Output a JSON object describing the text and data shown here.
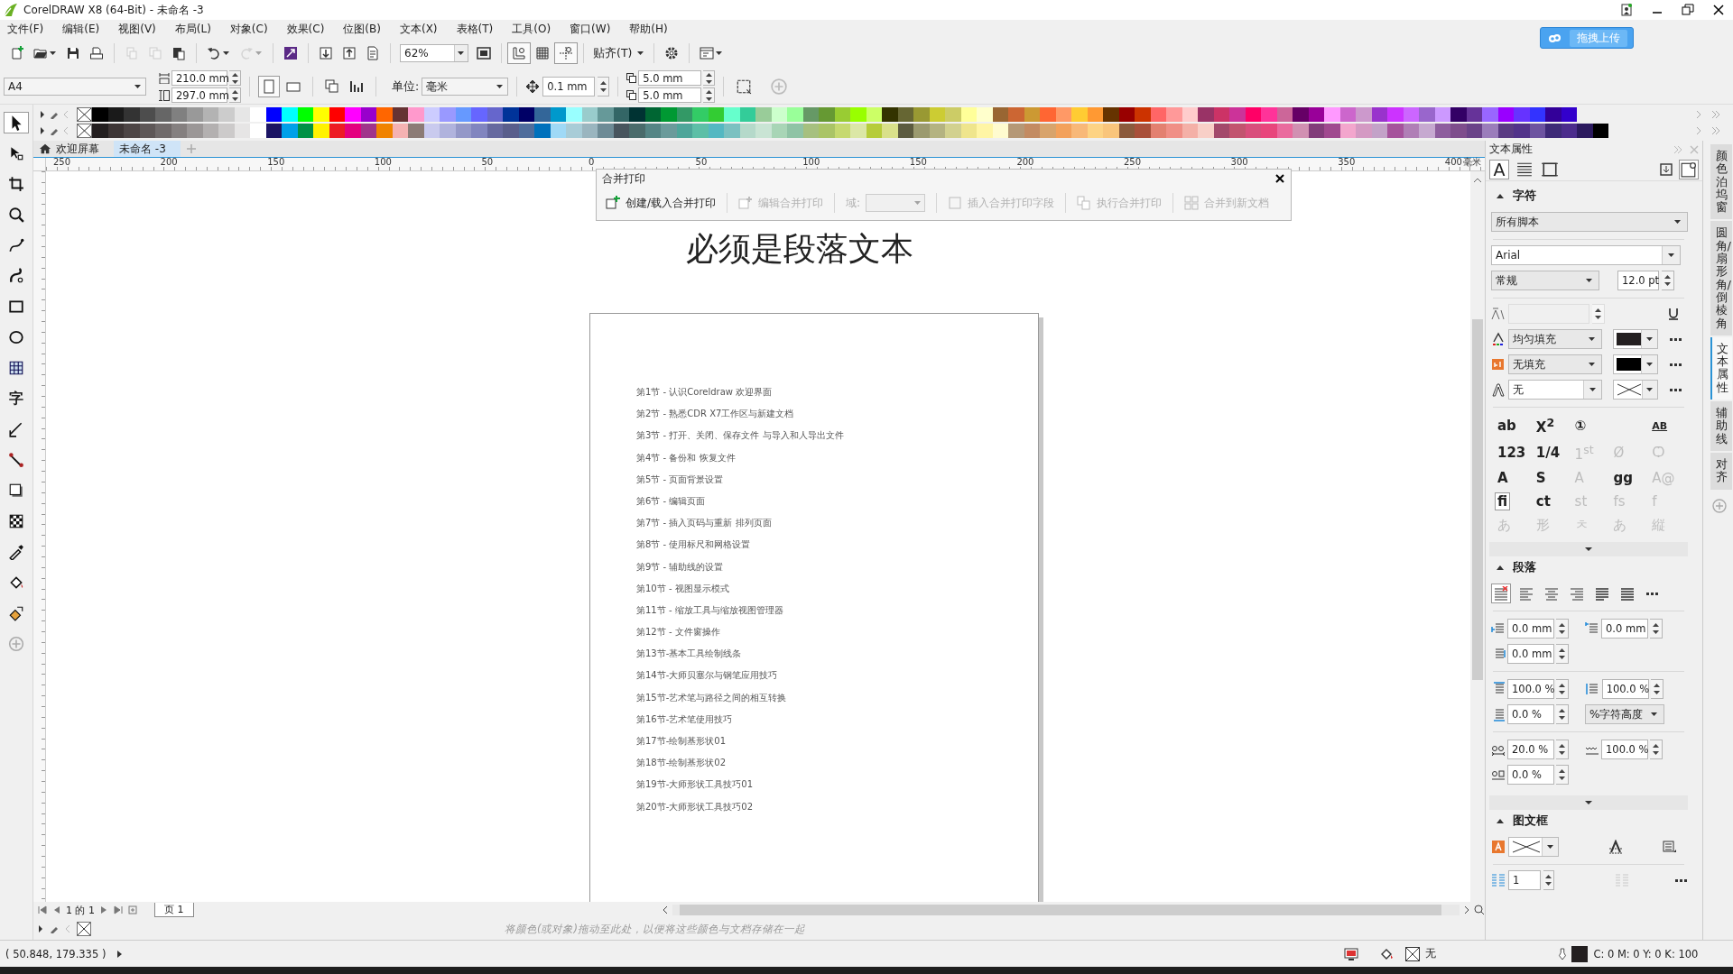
{
  "window": {
    "title": "CorelDRAW X8 (64-Bit) - 未命名 -3"
  },
  "menu": [
    "文件(F)",
    "编辑(E)",
    "视图(V)",
    "布局(L)",
    "对象(C)",
    "效果(C)",
    "位图(B)",
    "文本(X)",
    "表格(T)",
    "工具(O)",
    "窗口(W)",
    "帮助(H)"
  ],
  "upload_button": "拖拽上传",
  "standard_toolbar": [
    [
      {
        "kind": "new",
        "disabled": false
      },
      {
        "kind": "open",
        "disabled": false
      },
      {
        "kind": "save",
        "disabled": false
      },
      {
        "kind": "print",
        "disabled": false
      }
    ],
    [
      {
        "kind": "cut",
        "disabled": true
      },
      {
        "kind": "copy",
        "disabled": true
      },
      {
        "kind": "paste",
        "disabled": false
      }
    ],
    [
      {
        "kind": "undo",
        "disabled": false
      },
      {
        "kind": "redo",
        "disabled": true
      }
    ],
    [
      {
        "kind": "connect",
        "disabled": false
      }
    ],
    [
      {
        "kind": "import",
        "disabled": false
      },
      {
        "kind": "export",
        "disabled": false
      },
      {
        "kind": "pdf",
        "disabled": false
      }
    ],
    [
      {
        "kind": "zoom_level",
        "value": "62%"
      },
      {
        "kind": "fullscreen",
        "disabled": false
      }
    ],
    [
      {
        "kind": "rulers",
        "selected": true
      },
      {
        "kind": "grid",
        "selected": false
      },
      {
        "kind": "guides",
        "selected": true
      }
    ],
    [
      {
        "kind": "snap_menu",
        "label": "贴齐(T)"
      }
    ],
    [
      {
        "kind": "options",
        "disabled": false
      }
    ],
    [
      {
        "kind": "launcher",
        "disabled": false
      }
    ]
  ],
  "property_bar": {
    "page_size": "A4",
    "width": "210.0 mm",
    "height": "297.0 mm",
    "orientation": [
      {
        "kind": "portrait",
        "selected": true
      },
      {
        "kind": "landscape",
        "selected": false
      }
    ],
    "unit_label": "单位:",
    "unit": "毫米",
    "nudge": "0.1 mm",
    "duplicate_x": "5.0 mm",
    "duplicate_y": "5.0 mm"
  },
  "palette": {
    "rows": [
      [
        {
          "color": "#000000"
        },
        {
          "color": "#1a1a1a"
        },
        {
          "color": "#333333"
        },
        {
          "color": "#4d4d4d"
        },
        {
          "color": "#666666"
        },
        {
          "color": "#808080"
        },
        {
          "color": "#999999"
        },
        {
          "color": "#b3b3b3"
        },
        {
          "color": "#cccccc"
        },
        {
          "color": "#e6e6e6"
        },
        {
          "color": "#ffffff"
        },
        {
          "color": "#0000ff"
        },
        {
          "color": "#00ffff"
        },
        {
          "color": "#00ff00"
        },
        {
          "color": "#ffff00"
        },
        {
          "color": "#ff0000"
        },
        {
          "color": "#ff00ff"
        },
        {
          "color": "#9900cc"
        },
        {
          "color": "#ff6600"
        },
        {
          "color": "#663333"
        },
        {
          "color": "#ff99cc"
        },
        {
          "color": "#ccccff"
        },
        {
          "color": "#9999ff"
        },
        {
          "color": "#6699ff"
        },
        {
          "color": "#6666ff"
        },
        {
          "color": "#6666cc"
        },
        {
          "color": "#003399"
        },
        {
          "color": "#000066"
        },
        {
          "color": "#336699"
        },
        {
          "color": "#0099cc"
        },
        {
          "color": "#99ffff"
        },
        {
          "color": "#99cccc"
        },
        {
          "color": "#669999"
        },
        {
          "color": "#336666"
        },
        {
          "color": "#003333"
        },
        {
          "color": "#006633"
        },
        {
          "color": "#009933"
        },
        {
          "color": "#339966"
        },
        {
          "color": "#33cc66"
        },
        {
          "color": "#33cc33"
        },
        {
          "color": "#66ffcc"
        },
        {
          "color": "#33cc99"
        },
        {
          "color": "#99cc99"
        },
        {
          "color": "#ccffcc"
        },
        {
          "color": "#99ff99"
        },
        {
          "color": "#669966"
        },
        {
          "color": "#669933"
        },
        {
          "color": "#99cc33"
        },
        {
          "color": "#99ff00"
        },
        {
          "color": "#ccff66"
        },
        {
          "color": "#333300"
        },
        {
          "color": "#666633"
        },
        {
          "color": "#999933"
        },
        {
          "color": "#cccc33"
        },
        {
          "color": "#cccc66"
        },
        {
          "color": "#ffff99"
        },
        {
          "color": "#ffffcc"
        },
        {
          "color": "#996633"
        },
        {
          "color": "#cc6633"
        },
        {
          "color": "#cc9933"
        },
        {
          "color": "#ff6633"
        },
        {
          "color": "#ff9966"
        },
        {
          "color": "#ffcc33"
        },
        {
          "color": "#ff9933"
        },
        {
          "color": "#663300"
        },
        {
          "color": "#990000"
        },
        {
          "color": "#cc3300"
        },
        {
          "color": "#ff6666"
        },
        {
          "color": "#ff9999"
        },
        {
          "color": "#ffcccc"
        },
        {
          "color": "#993366"
        },
        {
          "color": "#cc3366"
        },
        {
          "color": "#cc3399"
        },
        {
          "color": "#ff0066"
        },
        {
          "color": "#ff3399"
        },
        {
          "color": "#cc6699"
        },
        {
          "color": "#660066"
        },
        {
          "color": "#990099"
        },
        {
          "color": "#ff99ff"
        },
        {
          "color": "#cc66cc"
        },
        {
          "color": "#cc99cc"
        },
        {
          "color": "#9933cc"
        },
        {
          "color": "#cc33ff"
        },
        {
          "color": "#cc66ff"
        },
        {
          "color": "#9966cc"
        },
        {
          "color": "#cc99ff"
        },
        {
          "color": "#330066"
        },
        {
          "color": "#663399"
        },
        {
          "color": "#9966ff"
        },
        {
          "color": "#9900ff"
        },
        {
          "color": "#6633ff"
        },
        {
          "color": "#3333ff"
        },
        {
          "color": "#330099"
        },
        {
          "color": "#3300cc"
        }
      ],
      [
        {
          "color": "#231f20"
        },
        {
          "color": "#3d3535"
        },
        {
          "color": "#4d4545"
        },
        {
          "color": "#5e5757"
        },
        {
          "color": "#706a6a"
        },
        {
          "color": "#858080"
        },
        {
          "color": "#9b9797"
        },
        {
          "color": "#b3b0b0"
        },
        {
          "color": "#cccaca"
        },
        {
          "color": "#e6e5e5"
        },
        {
          "color": "#ffffff"
        },
        {
          "color": "#1b1464"
        },
        {
          "color": "#00a0e9"
        },
        {
          "color": "#009245"
        },
        {
          "color": "#fff200"
        },
        {
          "color": "#ed1c24"
        },
        {
          "color": "#e4007f"
        },
        {
          "color": "#a0348b"
        },
        {
          "color": "#f08300"
        },
        {
          "color": "#f5b2b2"
        },
        {
          "color": "#8c7b75"
        },
        {
          "color": "#c9caee"
        },
        {
          "color": "#b0b3dd"
        },
        {
          "color": "#9498c8"
        },
        {
          "color": "#8185bf"
        },
        {
          "color": "#66699f"
        },
        {
          "color": "#595e8c"
        },
        {
          "color": "#4f6d9c"
        },
        {
          "color": "#0071bc"
        },
        {
          "color": "#9fd9f6"
        },
        {
          "color": "#a8ccd7"
        },
        {
          "color": "#9ab5bf"
        },
        {
          "color": "#6e8b96"
        },
        {
          "color": "#48555e"
        },
        {
          "color": "#4a6b6b"
        },
        {
          "color": "#558585"
        },
        {
          "color": "#6b9b9b"
        },
        {
          "color": "#4ea69a"
        },
        {
          "color": "#5dbfa7"
        },
        {
          "color": "#54b8c2"
        },
        {
          "color": "#7bc1c1"
        },
        {
          "color": "#b5d9ca"
        },
        {
          "color": "#c9e4d4"
        },
        {
          "color": "#a8d5b6"
        },
        {
          "color": "#8fc3a5"
        },
        {
          "color": "#a6c07f"
        },
        {
          "color": "#aac466"
        },
        {
          "color": "#c6d970"
        },
        {
          "color": "#dbe7a6"
        },
        {
          "color": "#b6cc3a"
        },
        {
          "color": "#d9e08a"
        },
        {
          "color": "#5c5b40"
        },
        {
          "color": "#9b9a6f"
        },
        {
          "color": "#b4b381"
        },
        {
          "color": "#d2d18f"
        },
        {
          "color": "#efe58c"
        },
        {
          "color": "#fff5a5"
        },
        {
          "color": "#fffbcf"
        },
        {
          "color": "#b59876"
        },
        {
          "color": "#c38b62"
        },
        {
          "color": "#d8a46c"
        },
        {
          "color": "#f3a15b"
        },
        {
          "color": "#f8b878"
        },
        {
          "color": "#fdd384"
        },
        {
          "color": "#f9c57b"
        },
        {
          "color": "#8b5a3c"
        },
        {
          "color": "#a9503a"
        },
        {
          "color": "#e38070"
        },
        {
          "color": "#f08f86"
        },
        {
          "color": "#f4b0a7"
        },
        {
          "color": "#f8cfc7"
        },
        {
          "color": "#a3496b"
        },
        {
          "color": "#c2546f"
        },
        {
          "color": "#d94e7c"
        },
        {
          "color": "#e8467c"
        },
        {
          "color": "#ea6b9e"
        },
        {
          "color": "#d190b2"
        },
        {
          "color": "#823d7a"
        },
        {
          "color": "#a0498f"
        },
        {
          "color": "#f3a6cd"
        },
        {
          "color": "#d49ac3"
        },
        {
          "color": "#c3a2c8"
        },
        {
          "color": "#a6539c"
        },
        {
          "color": "#b07fb6"
        },
        {
          "color": "#c6a9d0"
        },
        {
          "color": "#8e5e9e"
        },
        {
          "color": "#7e4d8c"
        },
        {
          "color": "#6a4388"
        },
        {
          "color": "#9b7dbb"
        },
        {
          "color": "#5a3b83"
        },
        {
          "color": "#52338a"
        },
        {
          "color": "#6d54a0"
        },
        {
          "color": "#3e2a77"
        },
        {
          "color": "#4b2c8c"
        },
        {
          "color": "#2b1a5e"
        },
        {
          "color": "#000000"
        }
      ]
    ]
  },
  "toolbox": [
    {
      "kind": "pick",
      "selected": true
    },
    {
      "kind": "shape",
      "selected": false
    },
    {
      "kind": "crop",
      "selected": false
    },
    {
      "kind": "zoom",
      "selected": false
    },
    {
      "kind": "freehand",
      "selected": false
    },
    {
      "kind": "artistic",
      "selected": false
    },
    {
      "kind": "rect",
      "selected": false
    },
    {
      "kind": "ellipse",
      "selected": false
    },
    {
      "kind": "graph",
      "selected": false
    },
    {
      "kind": "text",
      "label": "字",
      "selected": false
    },
    {
      "kind": "dimension",
      "selected": false
    },
    {
      "kind": "connector",
      "selected": false
    },
    {
      "kind": "shadow",
      "selected": false
    },
    {
      "kind": "transparency",
      "selected": false
    },
    {
      "kind": "eyedropper",
      "selected": false
    },
    {
      "kind": "fill",
      "selected": false
    },
    {
      "kind": "smartfill",
      "selected": false
    },
    {
      "kind": "add",
      "selected": false
    }
  ],
  "document_tabs": [
    {
      "kind": "home",
      "label": "欢迎屏幕",
      "selected": false
    },
    {
      "kind": "document",
      "label": "未命名 -3",
      "selected": true
    }
  ],
  "ruler": {
    "labels": [
      "250",
      "200",
      "150",
      "100",
      "50",
      "0",
      "50",
      "100",
      "150",
      "200",
      "250",
      "300",
      "350",
      "400"
    ],
    "unit": "毫米"
  },
  "merge_print": {
    "title": "合并打印",
    "items": [
      {
        "kind": "button",
        "label": "创建/载入合并打印",
        "disabled": false
      },
      {
        "kind": "button",
        "label": "编辑合并打印",
        "disabled": true
      },
      {
        "kind": "field",
        "label": "域:",
        "disabled": true
      },
      {
        "kind": "button",
        "label": "插入合并打印字段",
        "disabled": true
      },
      {
        "kind": "button",
        "label": "执行合并打印",
        "disabled": true
      },
      {
        "kind": "button",
        "label": "合并到新文档",
        "disabled": true
      }
    ]
  },
  "canvas": {
    "heading": "必须是段落文本",
    "page_lines": [
      "第1节 - 认识Coreldraw 欢迎界面",
      "第2节 - 熟悉CDR X7工作区与新建文档",
      "第3节 - 打开、关闭、保存文件 与导入和人导出文件",
      "第4节 - 备份和 恢复文件",
      "第5节 - 页面背景设置",
      "第6节 - 编辑页面",
      "第7节 - 插入页码与重新 排列页面",
      "第8节 - 使用标尺和网格设置",
      "第9节 - 辅助线的设置",
      "第10节 - 视图显示模式",
      "第11节 - 缩放工具与缩放视图管理器",
      "第12节 - 文件窗操作",
      "第13节-基本工具绘制线条",
      "第14节-大师贝塞尔与钢笔应用技巧",
      "第15节-艺术笔与路径之间的相互转换",
      "第16节-艺术笔使用技巧",
      "第17节-绘制基形状01",
      "第18节-绘制基形状02",
      "第19节-大师形状工具技巧01",
      "第20节-大师形状工具技巧02"
    ]
  },
  "page_navigator": {
    "position": "1 的 1",
    "pages": [
      {
        "label": "页 1",
        "selected": true
      }
    ]
  },
  "document_palette": {
    "hint": "将颜色(或对象)拖动至此处，以便将这些颜色与文档存储在一起"
  },
  "docker": {
    "title": "文本属性",
    "tabs": [
      {
        "kind": "character",
        "label": "A",
        "selected": true
      },
      {
        "kind": "paragraph",
        "selected": false
      },
      {
        "kind": "frame",
        "selected": false
      }
    ],
    "character": {
      "title": "字符",
      "expanded": true,
      "script": "所有脚本",
      "font": "Arial",
      "style": "常规",
      "size": "12.0 pt",
      "fill_type": "均匀填充",
      "background_fill": "无填充",
      "outline": "无",
      "opentype": [
        [
          {
            "label": "ab",
            "disabled": false
          },
          {
            "label": "X$^{2}$",
            "disabled": false
          },
          {
            "label": "①",
            "disabled": false
          },
          {
            "label": "AB",
            "disabled": false
          }
        ],
        [
          {
            "label": "123",
            "disabled": false
          },
          {
            "label": "1/4",
            "disabled": false
          },
          {
            "label": "1$^{st}$",
            "disabled": true
          },
          {
            "label": "Ø",
            "disabled": true
          },
          {
            "label": "Ѻ",
            "disabled": true
          }
        ],
        [
          {
            "label": "A",
            "disabled": false
          },
          {
            "label": "S",
            "disabled": false
          },
          {
            "label": "A",
            "disabled": true
          },
          {
            "label": "gg",
            "disabled": false
          },
          {
            "label": "A@",
            "disabled": true
          }
        ],
        [
          {
            "label": "ﬁ",
            "disabled": false,
            "selected": true
          },
          {
            "label": "ct",
            "disabled": false,
            "selected": false
          },
          {
            "label": "st",
            "disabled": true,
            "selected": false
          },
          {
            "label": "fs",
            "disabled": true,
            "selected": false
          },
          {
            "label": "f",
            "disabled": true,
            "selected": false
          }
        ],
        [
          {
            "label": "あ",
            "disabled": true
          },
          {
            "label": "形",
            "disabled": true
          },
          {
            "label": "ㅊ",
            "disabled": true
          },
          {
            "label": "あ",
            "disabled": true
          },
          {
            "label": "縦",
            "disabled": true
          }
        ]
      ]
    },
    "paragraph": {
      "title": "段落",
      "expanded": true,
      "alignment": [
        {
          "kind": "none",
          "selected": true
        },
        {
          "kind": "left",
          "selected": false
        },
        {
          "kind": "center",
          "selected": false
        },
        {
          "kind": "right",
          "selected": false
        },
        {
          "kind": "full",
          "selected": false
        },
        {
          "kind": "force",
          "selected": false
        }
      ],
      "left_indent": "0.0 mm",
      "first_line_indent": "0.0 mm",
      "right_indent": "0.0 mm",
      "before_spacing": "100.0 %",
      "line_spacing": "100.0 %",
      "after_spacing": "0.0 %",
      "spacing_unit": "%字符高度",
      "char_spacing": "20.0 %",
      "word_spacing": "100.0 %",
      "language_spacing": "0.0 %"
    },
    "frame": {
      "title": "图文框",
      "expanded": true,
      "columns": "1"
    }
  },
  "side_tabs": [
    {
      "label": "颜色泊坞窗",
      "selected": false
    },
    {
      "label": "圆角/扇形角/倒棱角",
      "selected": false
    },
    {
      "label": "文本属性",
      "selected": true
    },
    {
      "label": "辅助线",
      "selected": false
    },
    {
      "label": "对齐",
      "selected": false
    }
  ],
  "status_bar": {
    "coordinates": "( 50.848, 179.335 )",
    "fill": "无",
    "outline": "C: 0 M: 0 Y: 0 K: 100"
  }
}
